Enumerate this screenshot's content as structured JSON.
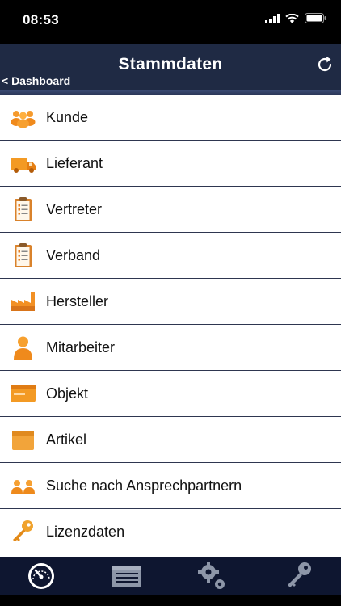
{
  "status_bar": {
    "time": "08:53"
  },
  "nav": {
    "title": "Stammdaten",
    "back_label": "< Dashboard"
  },
  "list": [
    {
      "label": "Kunde",
      "icon": "customers-icon"
    },
    {
      "label": "Lieferant",
      "icon": "truck-icon"
    },
    {
      "label": "Vertreter",
      "icon": "clipboard-icon"
    },
    {
      "label": "Verband",
      "icon": "clipboard-icon"
    },
    {
      "label": "Hersteller",
      "icon": "factory-icon"
    },
    {
      "label": "Mitarbeiter",
      "icon": "person-icon"
    },
    {
      "label": "Objekt",
      "icon": "card-icon"
    },
    {
      "label": "Artikel",
      "icon": "box-icon"
    },
    {
      "label": "Suche nach Ansprechpartnern",
      "icon": "contacts-search-icon"
    },
    {
      "label": "Lizenzdaten",
      "icon": "key-icon"
    }
  ],
  "tabbar": {
    "tabs": [
      "dashboard-icon",
      "list-icon",
      "settings-icon",
      "key-icon"
    ],
    "active": 0
  },
  "colors": {
    "nav_bg": "#1f2a44",
    "tab_bg": "#0e1630",
    "accent_orange": "#f28a1a"
  }
}
